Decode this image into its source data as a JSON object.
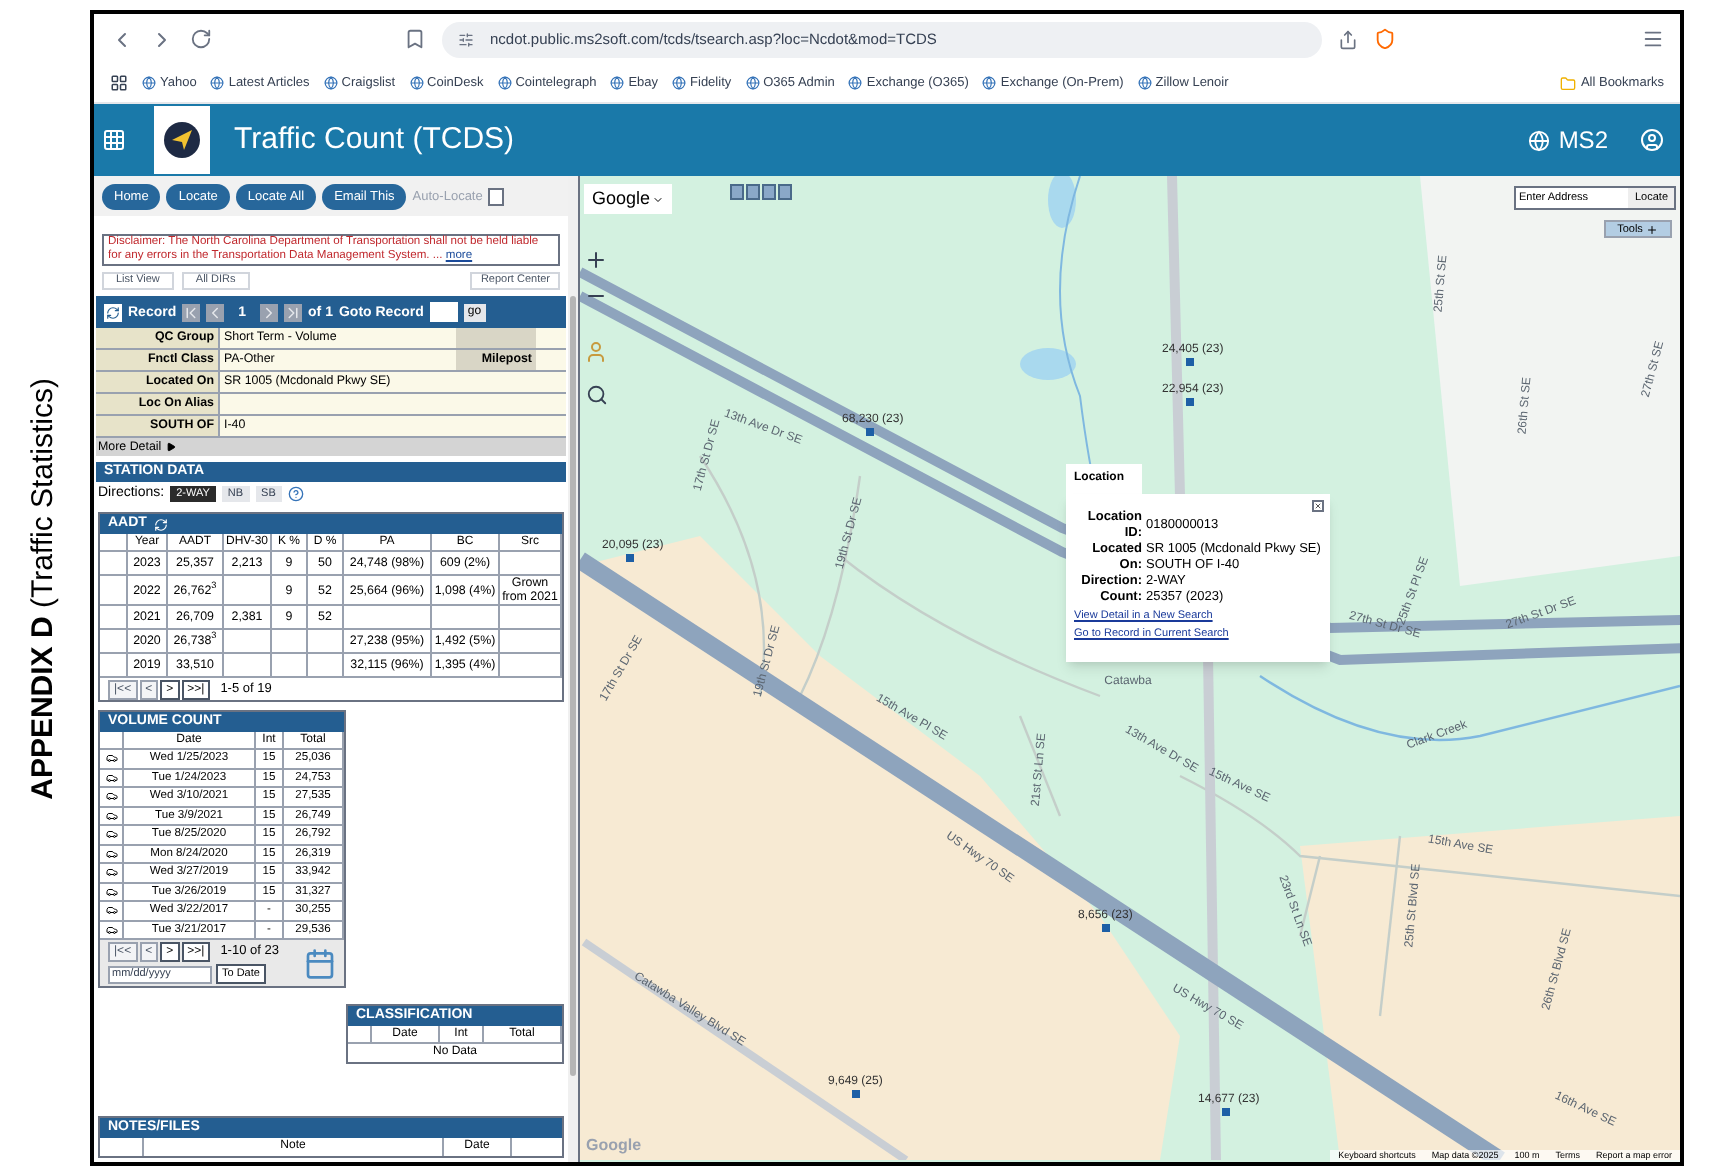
{
  "page_caption": "**APPENDIX D** (Traffic Statistics)",
  "browser": {
    "url": "ncdot.public.ms2soft.com/tcds/tsearch.asp?loc=Ncdot&mod=TCDS",
    "bookmarks": [
      "Yahoo",
      "Latest Articles",
      "Craigslist",
      "CoinDesk",
      "Cointelegraph",
      "Ebay",
      "Fidelity",
      "O365 Admin",
      "Exchange (O365)",
      "Exchange (On-Prem)",
      "Zillow Lenoir"
    ],
    "all_bookmarks": "All Bookmarks"
  },
  "app_header": {
    "title": "Traffic Count (TCDS)",
    "brand": "MS2"
  },
  "toolbar": {
    "buttons": [
      "Home",
      "Locate",
      "Locate All",
      "Email This"
    ],
    "auto_locate": {
      "label": "Auto-Locate",
      "checked": false
    }
  },
  "disclaimer": {
    "text": "Disclaimer: The North Carolina Department of Transportation shall not be held liable for any errors in the Transportation Data Management System. ...",
    "link": "more"
  },
  "view_buttons": [
    "List View",
    "All DIRs"
  ],
  "report_center": "Report Center",
  "record_bar": {
    "label": "Record",
    "current": "1",
    "total": "of 1",
    "goto_label": "Goto Record",
    "go": "go"
  },
  "info": [
    {
      "label": "QC Group",
      "value": "Short Term - Volume"
    },
    {
      "label": "Fnctl Class",
      "value": "PA-Other",
      "extra_label": "Milepost"
    },
    {
      "label": "Located On",
      "value": "SR 1005 (Mcdonald Pkwy SE)"
    },
    {
      "label": "Loc On Alias"
    },
    {
      "label": "SOUTH OF",
      "value": "I-40"
    }
  ],
  "more_detail": "More Detail",
  "station_data": {
    "title": "STATION DATA",
    "directions_label": "Directions:",
    "directions": [
      {
        "label": "2-WAY",
        "selected": true
      },
      {
        "label": "NB",
        "selected": false
      },
      {
        "label": "SB",
        "selected": false
      }
    ]
  },
  "aadt": {
    "title": "AADT",
    "columns": [
      "Year",
      "AADT",
      "DHV-30",
      "K %",
      "D %",
      "PA",
      "BC",
      "Src"
    ],
    "rows": [
      {
        "year": "2023",
        "aadt": "25,357",
        "dhv": "2,213",
        "k": "9",
        "d": "50",
        "pa": "24,748 (98%)",
        "bc": "609 (2%)"
      },
      {
        "year": "2022",
        "aadt": "26,762$^{3}$",
        "k": "9",
        "d": "52",
        "pa": "25,664 (96%)",
        "bc": "1,098 (4%)",
        "src": "Grown from 2021"
      },
      {
        "year": "2021",
        "aadt": "26,709",
        "dhv": "2,381",
        "k": "9",
        "d": "52"
      },
      {
        "year": "2020",
        "aadt": "26,738$^{3}$",
        "pa": "27,238 (95%)",
        "bc": "1,492 (5%)"
      },
      {
        "year": "2019",
        "aadt": "33,510",
        "pa": "32,115 (96%)",
        "bc": "1,395 (4%)"
      }
    ],
    "pager": [
      {
        "label": "|<<",
        "disabled": true
      },
      {
        "label": "<",
        "disabled": true
      },
      {
        "label": ">",
        "disabled": false
      },
      {
        "label": ">>|",
        "disabled": false
      }
    ],
    "range": "1-5 of 19"
  },
  "volume_count": {
    "title": "VOLUME COUNT",
    "columns": [
      "Date",
      "Int",
      "Total"
    ],
    "rows": [
      [
        "Wed 1/25/2023",
        "15",
        "25,036"
      ],
      [
        "Tue 1/24/2023",
        "15",
        "24,753"
      ],
      [
        "Wed 3/10/2021",
        "15",
        "27,535"
      ],
      [
        "Tue 3/9/2021",
        "15",
        "26,749"
      ],
      [
        "Tue 8/25/2020",
        "15",
        "26,792"
      ],
      [
        "Mon 8/24/2020",
        "15",
        "26,319"
      ],
      [
        "Wed 3/27/2019",
        "15",
        "33,942"
      ],
      [
        "Tue 3/26/2019",
        "15",
        "31,327"
      ],
      [
        "Wed 3/22/2017",
        "-",
        "30,255"
      ],
      [
        "Tue 3/21/2017",
        "-",
        "29,536"
      ]
    ],
    "pager": [
      {
        "label": "|<<",
        "disabled": true
      },
      {
        "label": "<",
        "disabled": true
      },
      {
        "label": ">",
        "disabled": false
      },
      {
        "label": ">>|",
        "disabled": false
      }
    ],
    "range": "1-10 of 23",
    "date_placeholder": "mm/dd/yyyy",
    "to_date": "To Date"
  },
  "classification": {
    "title": "CLASSIFICATION",
    "columns": [
      "Date",
      "Int",
      "Total"
    ],
    "empty": "No Data"
  },
  "notes": {
    "title": "NOTES/FILES",
    "columns": [
      "Note",
      "Date"
    ]
  },
  "map": {
    "provider": "Google",
    "address_placeholder": "Enter Address",
    "locate": "Locate",
    "tools": "Tools",
    "street_labels": [
      "13th Ave Dr SE",
      "17th St Dr SE",
      "19th St Dr SE",
      "17th St Dr SE",
      "19th St Dr SE",
      "15th Ave Pl SE",
      "21st St Ln SE",
      "13th Ave Dr SE",
      "15th Ave SE",
      "Clark Creek",
      "US Hwy 70 SE",
      "US Hwy 70 SE",
      "Catawba Valley Blvd SE",
      "23rd St Ln SE",
      "15th Ave SE",
      "25th St Blvd SE",
      "26th St Blvd SE",
      "16th Ave SE",
      "25th St SE",
      "26th St SE",
      "27th St SE",
      "27th St Dr SE",
      "27th St Dr SE",
      "25th St Pl SE",
      "Catawba"
    ],
    "count_labels": [
      "24,405 (23)",
      "22,954 (23)",
      "68,230 (23)",
      "20,095 (23)",
      "8,656 (23)",
      "9,649 (25)",
      "14,677 (23)"
    ],
    "popup": {
      "tab": "Location",
      "fields": [
        {
          "label": "Location ID:",
          "lines": [
            "0180000013"
          ]
        },
        {
          "label": "Located On:",
          "lines": [
            "SR 1005 (Mcdonald Pkwy SE)",
            "SOUTH OF I-40"
          ]
        },
        {
          "label": "Direction:",
          "lines": [
            "2-WAY"
          ]
        },
        {
          "label": "Count:",
          "lines": [
            "25357 (2023)"
          ]
        }
      ],
      "links": [
        "View Detail in a New Search",
        "Go to Record in Current Search"
      ]
    },
    "logo": "Google",
    "attribution": [
      "Keyboard shortcuts",
      "Map data ©2025",
      "100 m",
      "Terms",
      "Report a map error"
    ]
  }
}
